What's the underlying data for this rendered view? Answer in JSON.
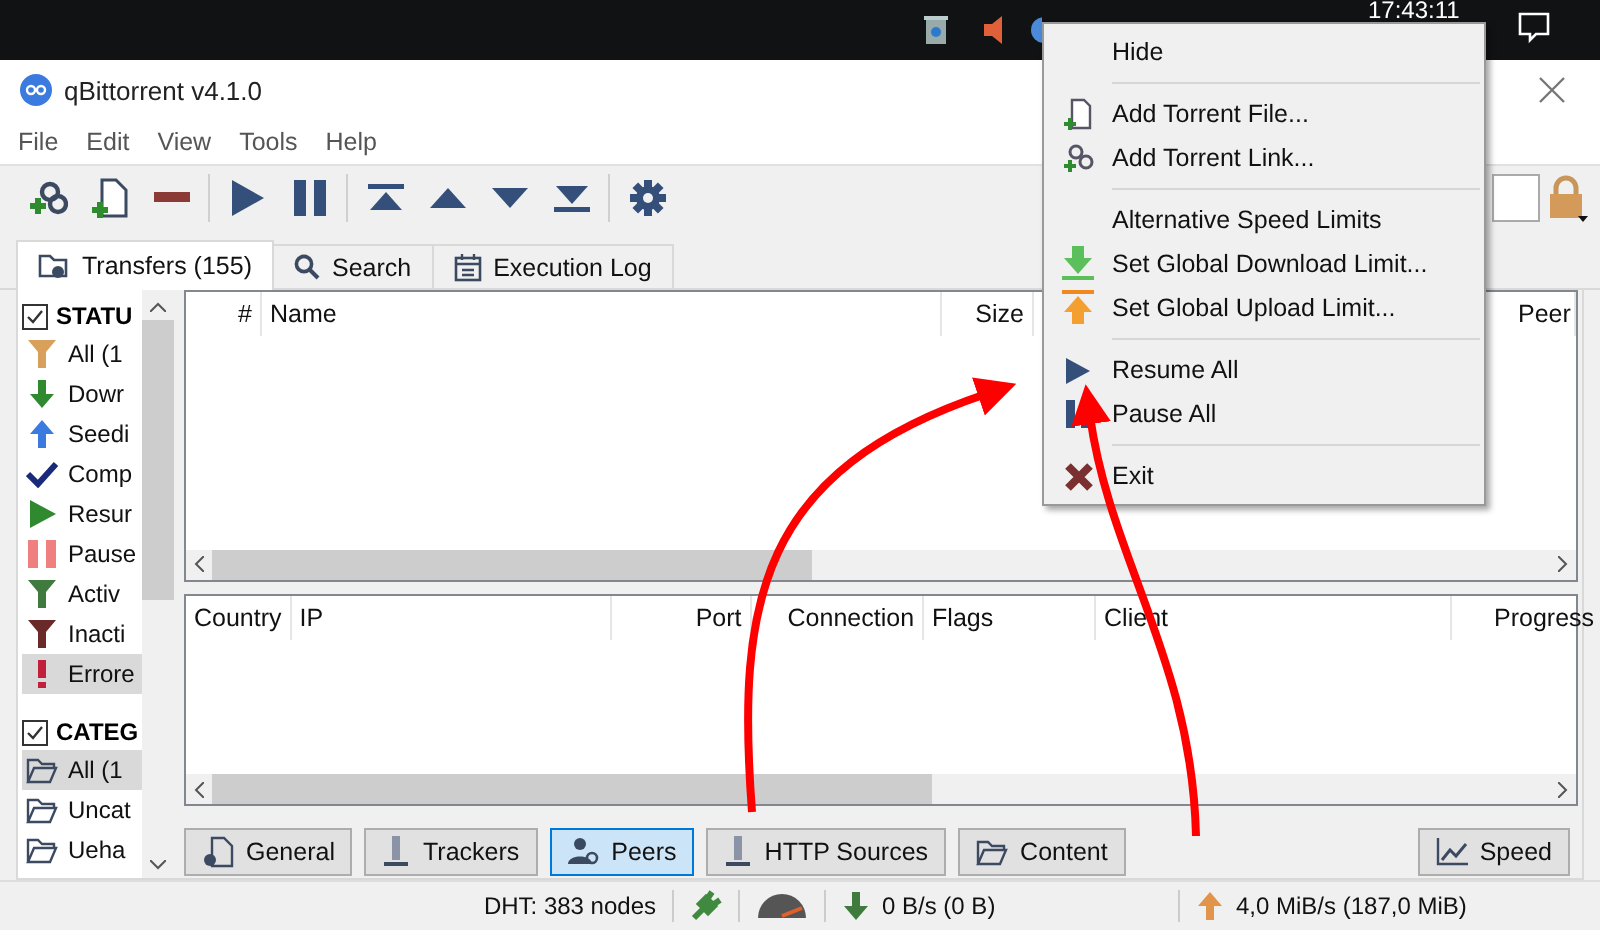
{
  "taskbar": {
    "clock": "17:43:11"
  },
  "window": {
    "title": "qBittorrent v4.1.0"
  },
  "menu_bar": [
    "File",
    "Edit",
    "View",
    "Tools",
    "Help"
  ],
  "tabs": [
    {
      "label": "Transfers (155)",
      "kind": "transfers",
      "selected": true
    },
    {
      "label": "Search",
      "kind": "search",
      "selected": false
    },
    {
      "label": "Execution Log",
      "kind": "log",
      "selected": false
    }
  ],
  "sidebar": {
    "sections": [
      {
        "title": "STATU",
        "checked": true,
        "items": [
          {
            "label": "All (1",
            "kind": "all",
            "selected": false
          },
          {
            "label": "Dowr",
            "kind": "downloading",
            "selected": false
          },
          {
            "label": "Seedi",
            "kind": "seeding",
            "selected": false
          },
          {
            "label": "Comp",
            "kind": "completed",
            "selected": false
          },
          {
            "label": "Resur",
            "kind": "resumed",
            "selected": false
          },
          {
            "label": "Pause",
            "kind": "paused",
            "selected": false
          },
          {
            "label": "Activ",
            "kind": "active",
            "selected": false
          },
          {
            "label": "Inacti",
            "kind": "inactive",
            "selected": false
          },
          {
            "label": "Errore",
            "kind": "errored",
            "selected": true
          }
        ]
      },
      {
        "title": "CATEG",
        "checked": true,
        "items": [
          {
            "label": "All (1",
            "kind": "folder",
            "selected": true
          },
          {
            "label": "Uncat",
            "kind": "folder",
            "selected": false
          },
          {
            "label": "Ueha",
            "kind": "folder",
            "selected": false
          }
        ]
      }
    ]
  },
  "transfers_table": {
    "columns": [
      "#",
      "Name",
      "Size",
      "Peer"
    ]
  },
  "peers_table": {
    "columns": [
      "Country",
      "IP",
      "Port",
      "Connection",
      "Flags",
      "Client",
      "Progress"
    ]
  },
  "detail_tabs": [
    {
      "label": "General",
      "kind": "general",
      "selected": false
    },
    {
      "label": "Trackers",
      "kind": "trackers",
      "selected": false
    },
    {
      "label": "Peers",
      "kind": "peers",
      "selected": true
    },
    {
      "label": "HTTP Sources",
      "kind": "trackers",
      "selected": false
    },
    {
      "label": "Content",
      "kind": "folder",
      "selected": false
    }
  ],
  "speed_button": "Speed",
  "status_bar": {
    "dht": "DHT: 383 nodes",
    "download": "0 B/s (0 B)",
    "upload": "4,0 MiB/s (187,0 MiB)"
  },
  "context_menu": {
    "items": [
      {
        "kind": "plain",
        "label": "Hide"
      },
      {
        "kind": "separator"
      },
      {
        "kind": "file",
        "label": "Add Torrent File..."
      },
      {
        "kind": "link",
        "label": "Add Torrent Link..."
      },
      {
        "kind": "separator"
      },
      {
        "kind": "plain",
        "label": "Alternative Speed Limits"
      },
      {
        "kind": "download",
        "label": "Set Global Download Limit..."
      },
      {
        "kind": "upload",
        "label": "Set Global Upload Limit..."
      },
      {
        "kind": "separator"
      },
      {
        "kind": "resume",
        "label": "Resume All"
      },
      {
        "kind": "pause",
        "label": "Pause All"
      },
      {
        "kind": "separator"
      },
      {
        "kind": "exit",
        "label": "Exit"
      }
    ]
  }
}
